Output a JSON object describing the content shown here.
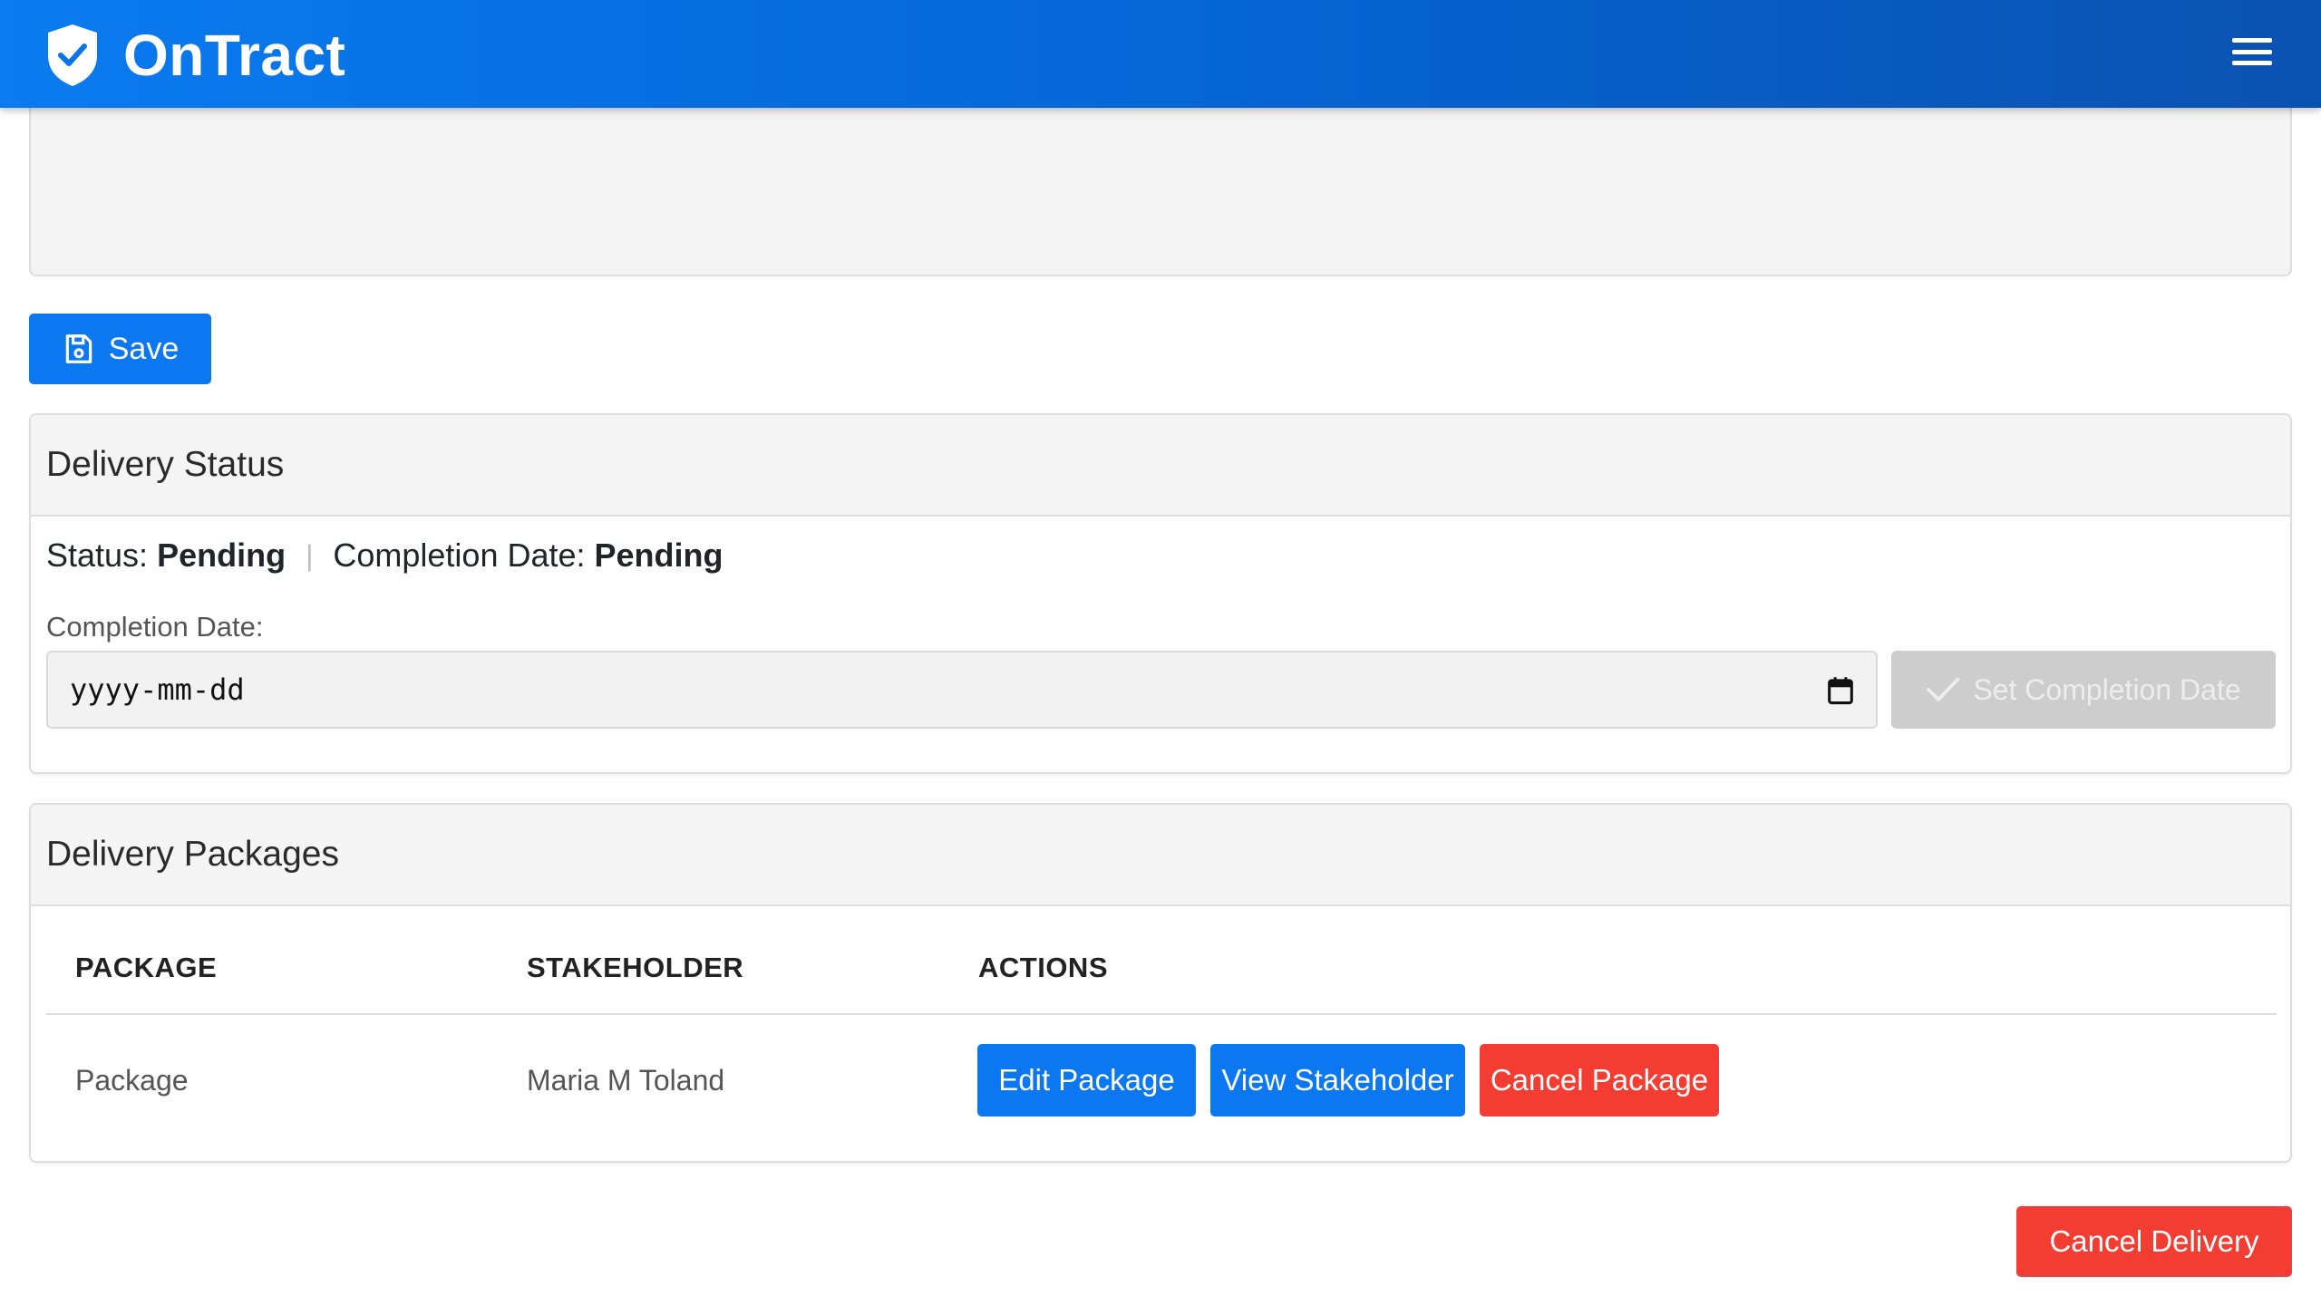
{
  "app": {
    "name": "OnTract"
  },
  "toolbar": {
    "save_label": "Save"
  },
  "status_card": {
    "title": "Delivery Status",
    "status_label": "Status:",
    "status_value": "Pending",
    "completion_label": "Completion Date:",
    "completion_value": "Pending",
    "date_field_label": "Completion Date:",
    "date_placeholder": "yyyy-mm-dd",
    "set_date_button": "Set Completion Date"
  },
  "packages_card": {
    "title": "Delivery Packages",
    "columns": [
      "PACKAGE",
      "STAKEHOLDER",
      "ACTIONS"
    ],
    "rows": [
      {
        "package": "Package",
        "stakeholder": "Maria M Toland",
        "actions": [
          "Edit Package",
          "View Stakeholder",
          "Cancel Package"
        ]
      }
    ]
  },
  "footer": {
    "cancel_delivery": "Cancel Delivery"
  },
  "colors": {
    "primary": "#0b78f2",
    "danger": "#f33d33",
    "disabled": "#cdcdcd",
    "header_gradient_start": "#0a7bf0",
    "header_gradient_end": "#0a52b0"
  },
  "icons": [
    "shield-check-icon",
    "hamburger-menu-icon",
    "save-icon",
    "calendar-icon",
    "checkmark-icon"
  ]
}
